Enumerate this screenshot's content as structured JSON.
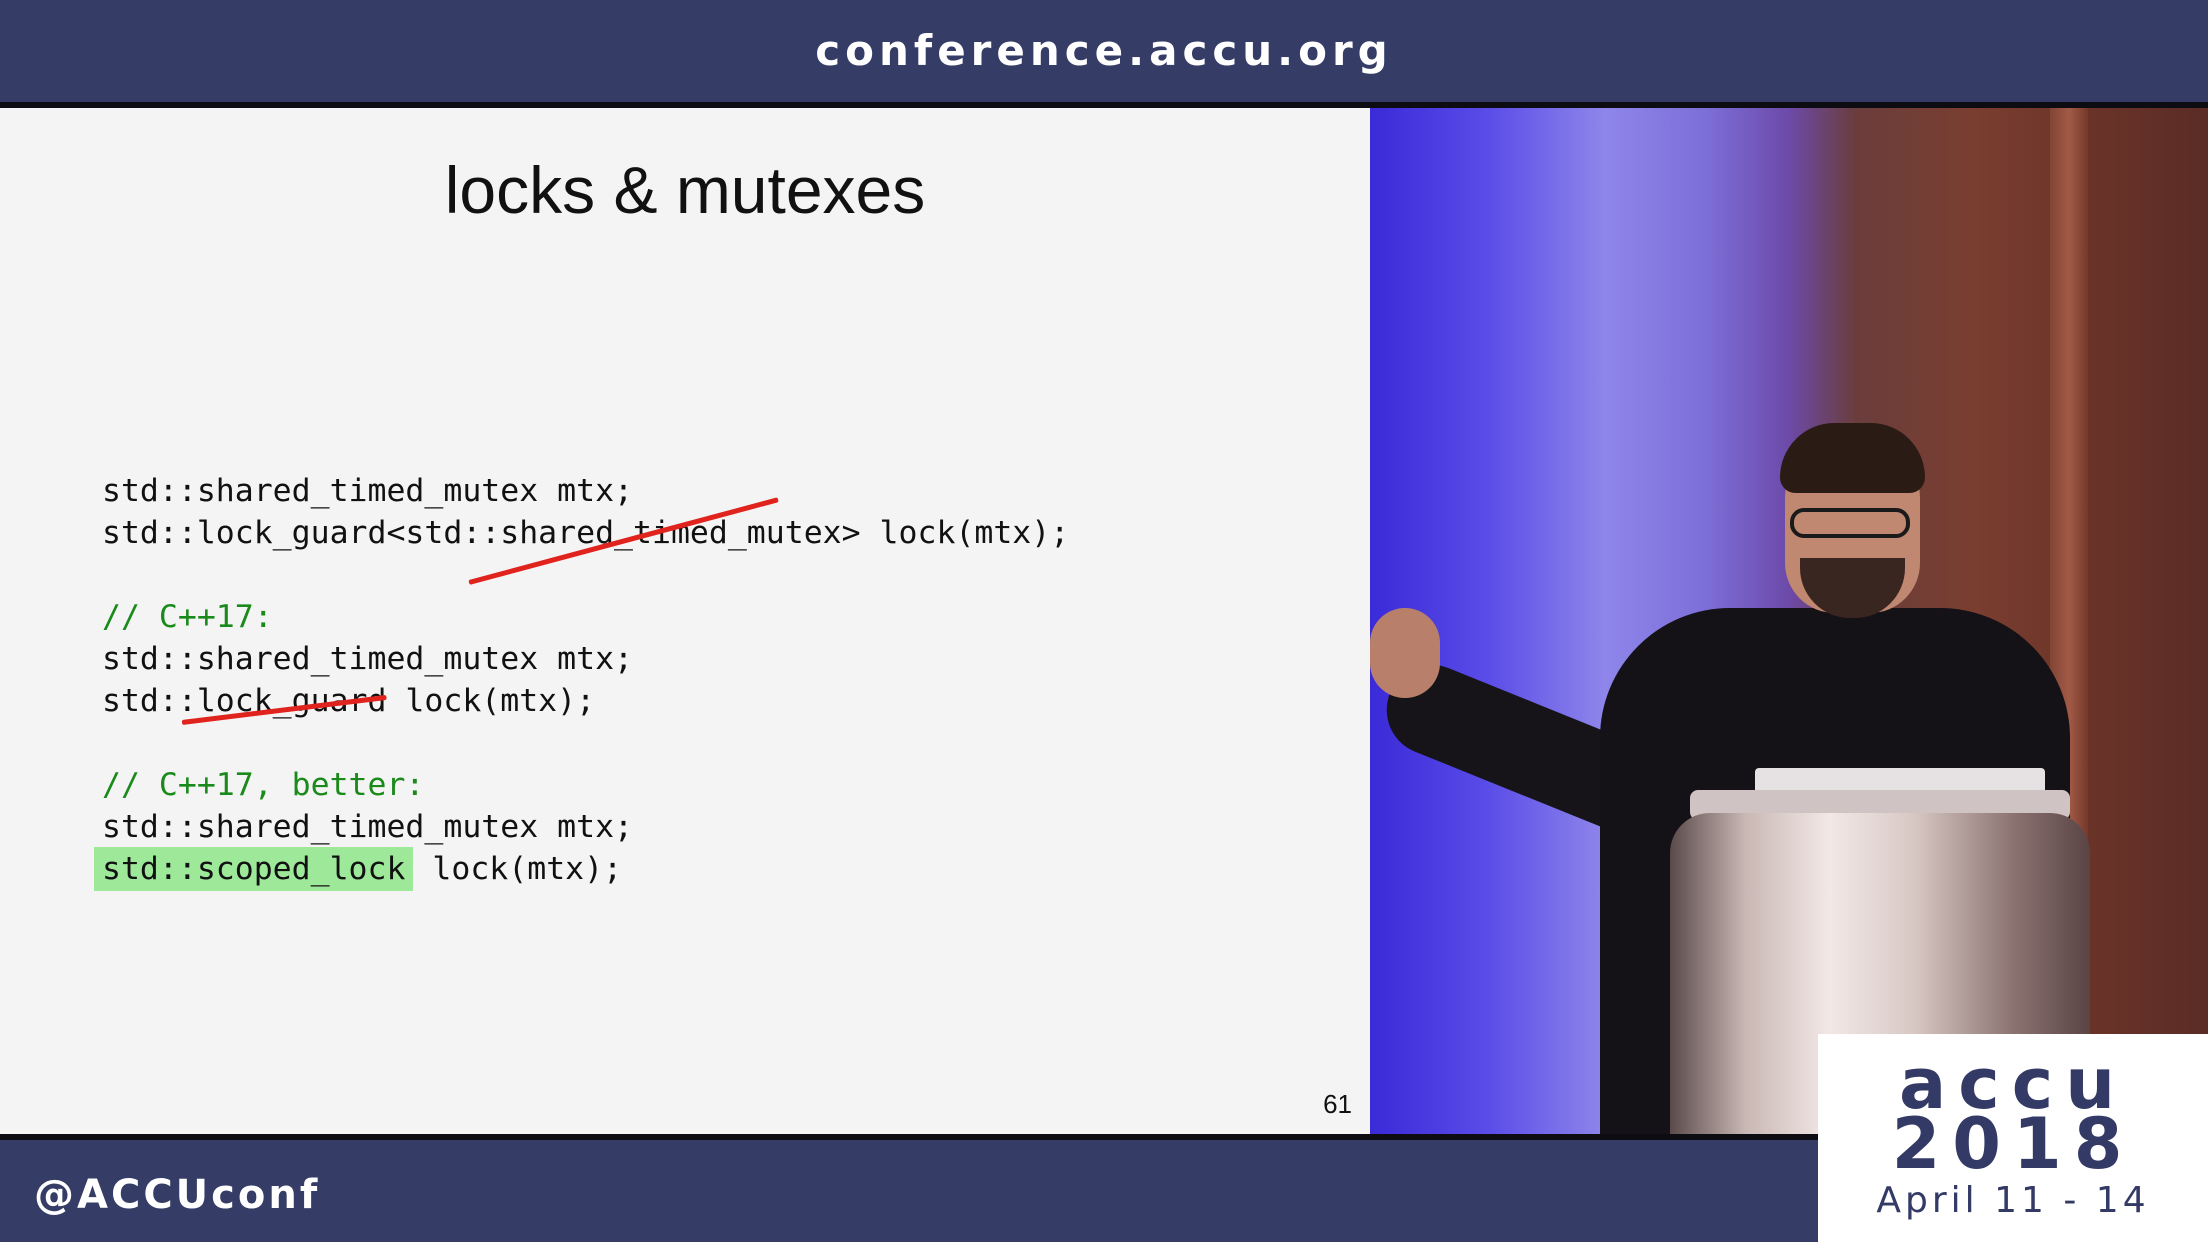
{
  "header": {
    "url": "conference.accu.org"
  },
  "footer": {
    "handle": "@ACCUconf"
  },
  "logo": {
    "name": "accu",
    "year": "2018",
    "dates": "April 11 - 14"
  },
  "slide": {
    "title": "locks & mutexes",
    "page_number": "61",
    "code_lines": [
      "std::shared_timed_mutex mtx;",
      "std::lock_guard<std::shared_timed_mutex> lock(mtx);",
      "// C++17:",
      "std::shared_timed_mutex mtx;",
      "std::lock_guard lock(mtx);",
      "// C++17, better:",
      "std::shared_timed_mutex mtx;",
      "std::scoped_lock",
      " lock(mtx);"
    ]
  },
  "colors": {
    "banner": "#353c66",
    "comment": "#1a8a1a",
    "highlight": "#9ee89a",
    "strike": "#e0231d"
  }
}
